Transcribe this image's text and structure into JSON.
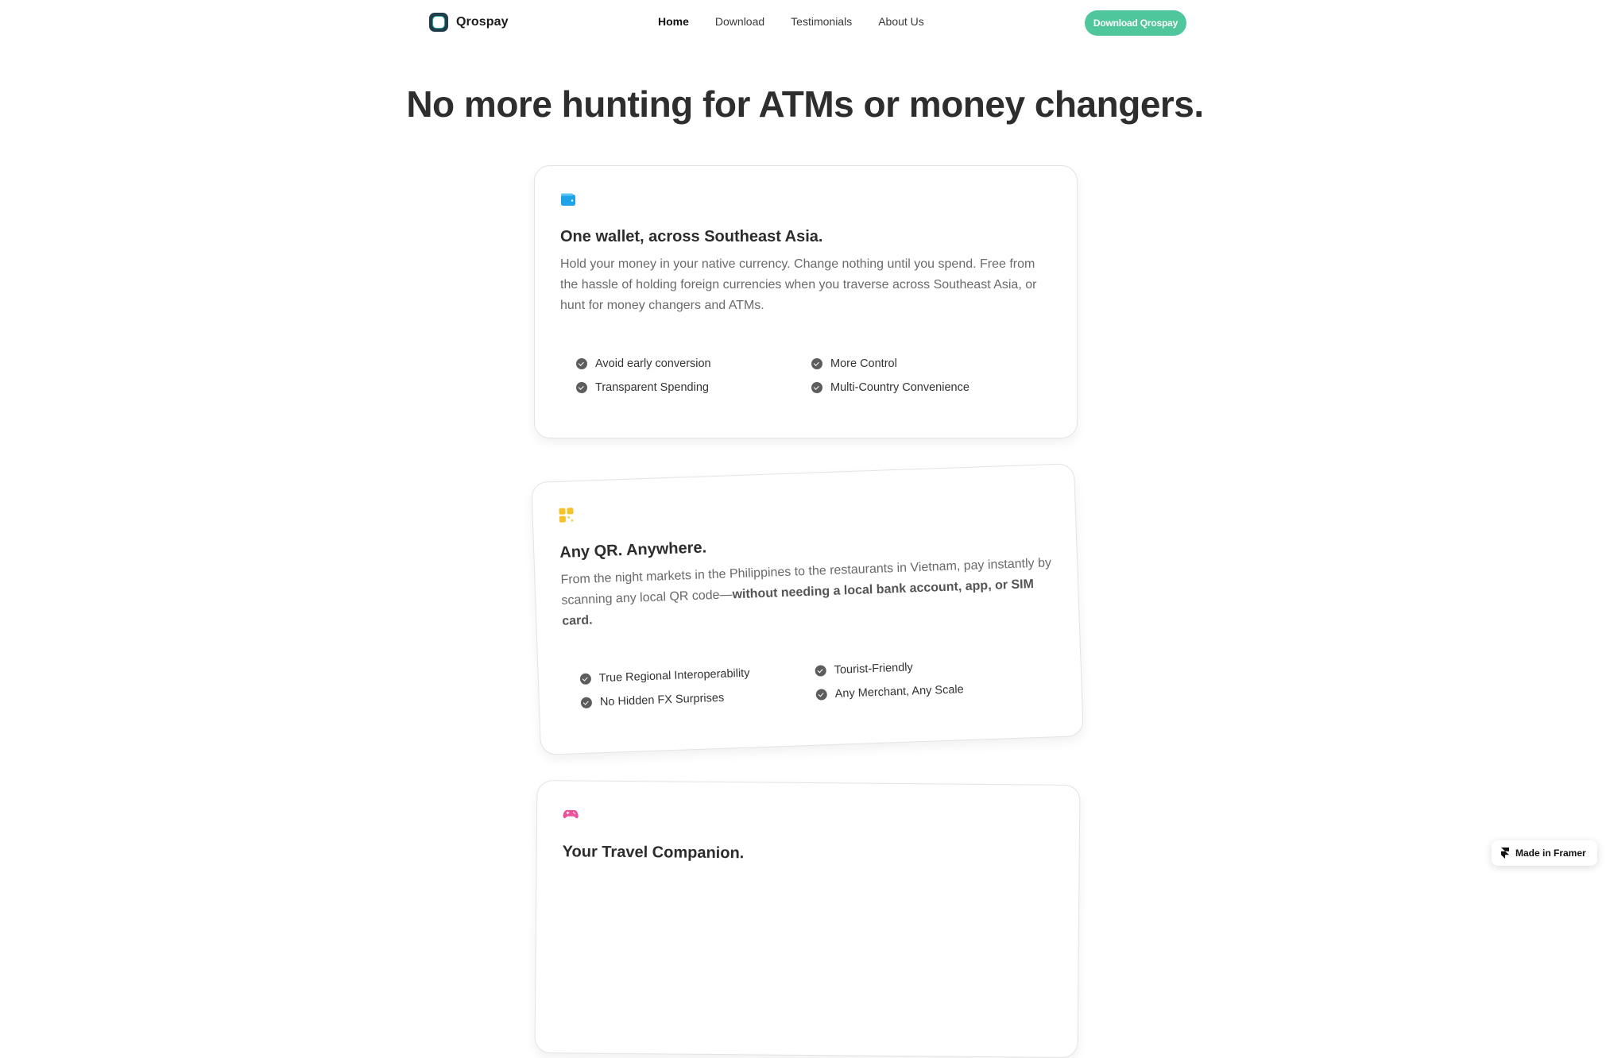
{
  "brand": {
    "name": "Qrospay"
  },
  "nav": {
    "items": [
      {
        "label": "Home"
      },
      {
        "label": "Download"
      },
      {
        "label": "Testimonials"
      },
      {
        "label": "About Us"
      }
    ],
    "active": "Home",
    "cta_label": "Download Qrospay"
  },
  "hero": {
    "title": "No more hunting for ATMs or money changers."
  },
  "cards": [
    {
      "icon": "wallet-icon",
      "icon_color": "#1fa3e8",
      "title": "One wallet, across Southeast Asia.",
      "description": "Hold your money in your native currency. Change nothing until you spend. Free from the hassle of holding foreign currencies when you traverse across Southeast Asia, or hunt for money changers and ATMs.",
      "features": [
        "Avoid early conversion",
        "More Control",
        "Transparent Spending",
        "Multi-Country Convenience"
      ]
    },
    {
      "icon": "qr-grid-icon",
      "icon_color": "#f5c22b",
      "title": "Any QR. Anywhere.",
      "description_plain": "From the night markets in the Philippines to the restaurants in Vietnam, pay instantly by scanning any local QR code—",
      "description_bold": "without needing a local bank account, app, or SIM card.",
      "features": [
        "True Regional Interoperability",
        "Tourist-Friendly",
        "No Hidden FX Surprises",
        "Any Merchant, Any Scale"
      ]
    },
    {
      "icon": "gamepad-icon",
      "icon_color": "#ec4f9b",
      "title": "Your Travel Companion."
    }
  ],
  "badge": {
    "label": "Made in Framer"
  },
  "colors": {
    "accent": "#4fc69c",
    "text": "#2e2e2e",
    "muted": "#6a6a6a"
  }
}
